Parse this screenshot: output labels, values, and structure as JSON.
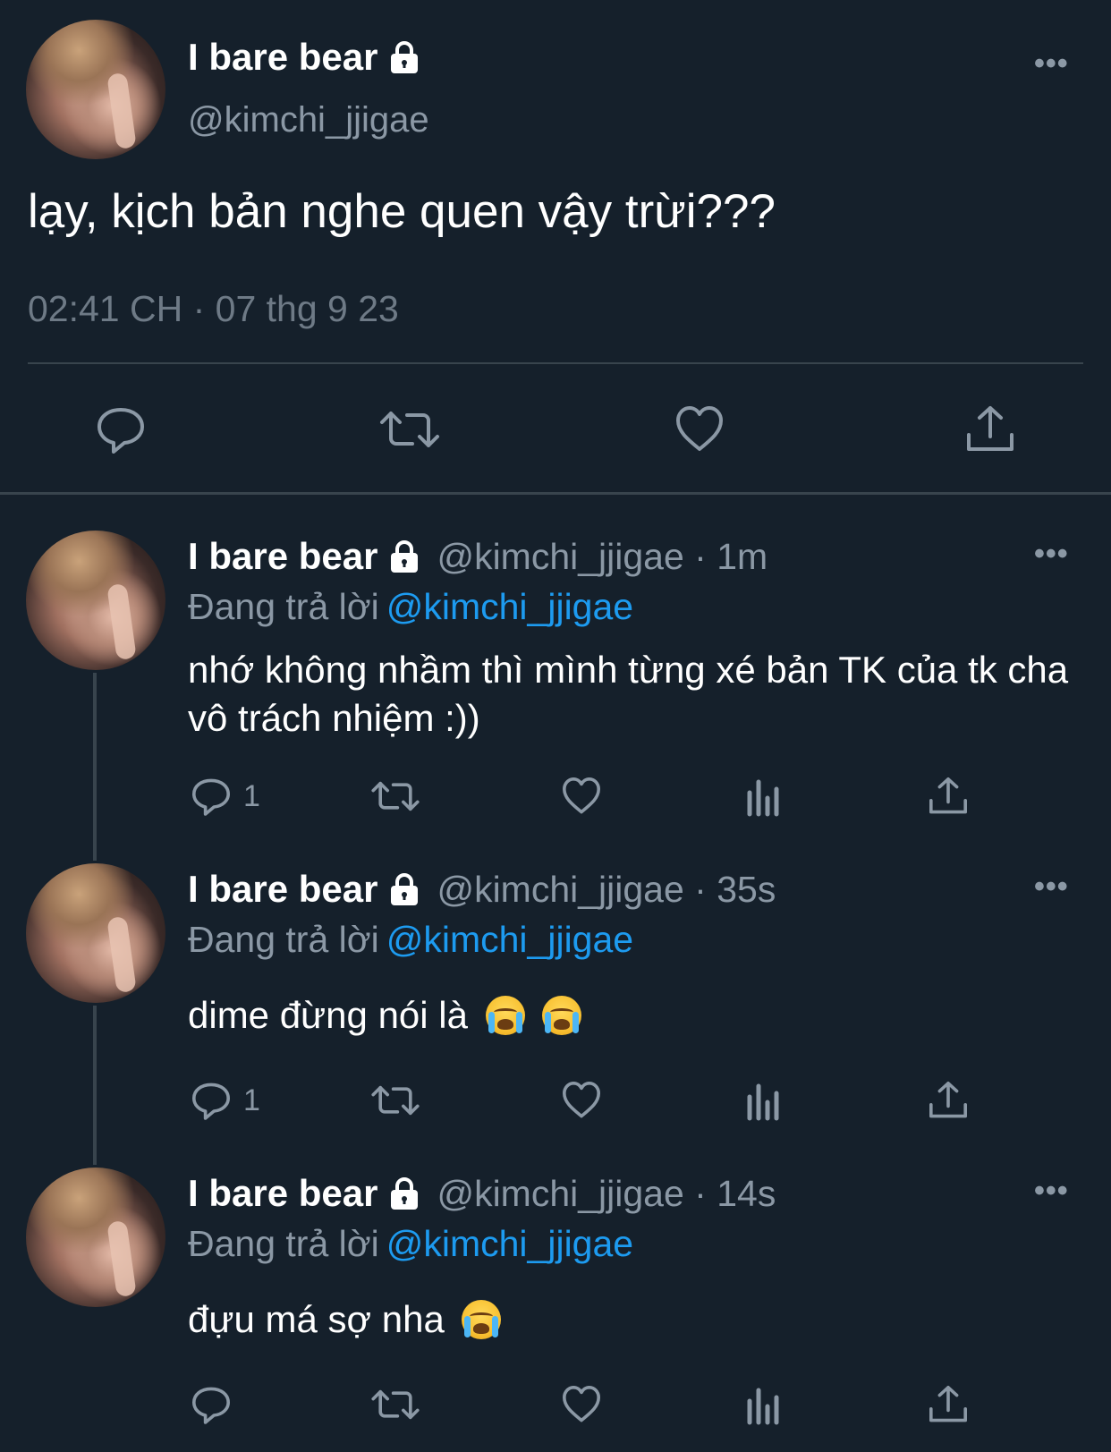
{
  "main_tweet": {
    "display_name": "I bare bear",
    "handle": "@kimchi_jjigae",
    "text": "lạy, kịch bản nghe quen vậy trừi???",
    "timestamp": "02:41 CH · 07 thg 9 23",
    "more_label": "•••",
    "icons": [
      "reply-icon",
      "retweet-icon",
      "like-icon",
      "share-icon"
    ]
  },
  "replies": [
    {
      "display_name": "I bare bear",
      "meta": "@kimchi_jjigae · 1m",
      "replying_label": "Đang trả lời",
      "replying_to": "@kimchi_jjigae",
      "text": "nhớ không nhầm thì mình từng xé bản TK của tk cha vô trách nhiệm :))",
      "reply_count": "1",
      "more_label": "•••"
    },
    {
      "display_name": "I bare bear",
      "meta": "@kimchi_jjigae · 35s",
      "replying_label": "Đang trả lời",
      "replying_to": "@kimchi_jjigae",
      "text": "dime đừng nói là",
      "emojis": [
        "loudly-crying-face",
        "loudly-crying-face"
      ],
      "reply_count": "1",
      "more_label": "•••"
    },
    {
      "display_name": "I bare bear",
      "meta": "@kimchi_jjigae · 14s",
      "replying_label": "Đang trả lời",
      "replying_to": "@kimchi_jjigae",
      "text": "đựu má sợ nha",
      "emojis": [
        "loudly-crying-face"
      ],
      "reply_count": "",
      "more_label": "•••"
    }
  ],
  "colors": {
    "background": "#15202b",
    "secondary_text": "#8b98a5",
    "link": "#1d9bf0",
    "divider": "#38444d"
  }
}
